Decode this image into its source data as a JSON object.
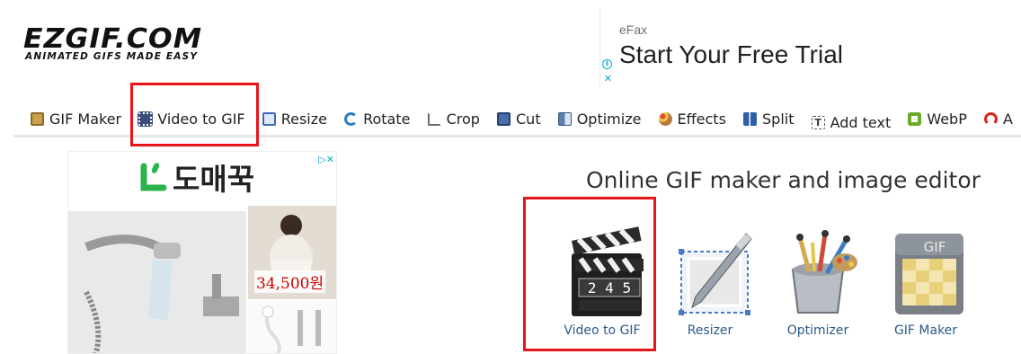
{
  "logo": {
    "main": "EZGIF.COM",
    "tagline": "ANIMATED GIFS MADE EASY"
  },
  "top_ad": {
    "brand": "eFax",
    "title": "Start Your Free Trial"
  },
  "nav": {
    "items": [
      {
        "label": "GIF Maker",
        "icon": "gif-maker-icon",
        "color": "#c9a14a"
      },
      {
        "label": "Video to GIF",
        "icon": "film-icon",
        "color": "#3b4e7a"
      },
      {
        "label": "Resize",
        "icon": "resize-icon",
        "color": "#3f6ab5"
      },
      {
        "label": "Rotate",
        "icon": "rotate-icon",
        "color": "#2d7fc1"
      },
      {
        "label": "Crop",
        "icon": "crop-icon",
        "color": "#6b6b6b"
      },
      {
        "label": "Cut",
        "icon": "cut-icon",
        "color": "#4a6ca8"
      },
      {
        "label": "Optimize",
        "icon": "optimize-icon",
        "color": "#5a7fb0"
      },
      {
        "label": "Effects",
        "icon": "palette-icon",
        "color": "#b87a3a"
      },
      {
        "label": "Split",
        "icon": "split-icon",
        "color": "#2d5fa8"
      },
      {
        "label": "Add text",
        "icon": "text-icon",
        "color": "#555555"
      },
      {
        "label": "WebP",
        "icon": "webp-icon",
        "color": "#6cab2a"
      },
      {
        "label": "A",
        "icon": "apng-icon",
        "color": "#d9261c"
      }
    ]
  },
  "side_ad": {
    "brand": "도매꾹",
    "price": "34,500원"
  },
  "main": {
    "headline": "Online GIF maker and image editor",
    "tools": [
      {
        "label": "Video to GIF",
        "icon": "clapperboard-icon",
        "digits": "2 4 5"
      },
      {
        "label": "Resizer",
        "icon": "resizer-icon"
      },
      {
        "label": "Optimizer",
        "icon": "optimizer-icon"
      },
      {
        "label": "GIF Maker",
        "icon": "gif-maker-icon",
        "badge": "GIF"
      }
    ]
  },
  "colors": {
    "highlight": "#e8141a",
    "link": "#2a5a8a",
    "accent_green": "#2bb24c"
  }
}
